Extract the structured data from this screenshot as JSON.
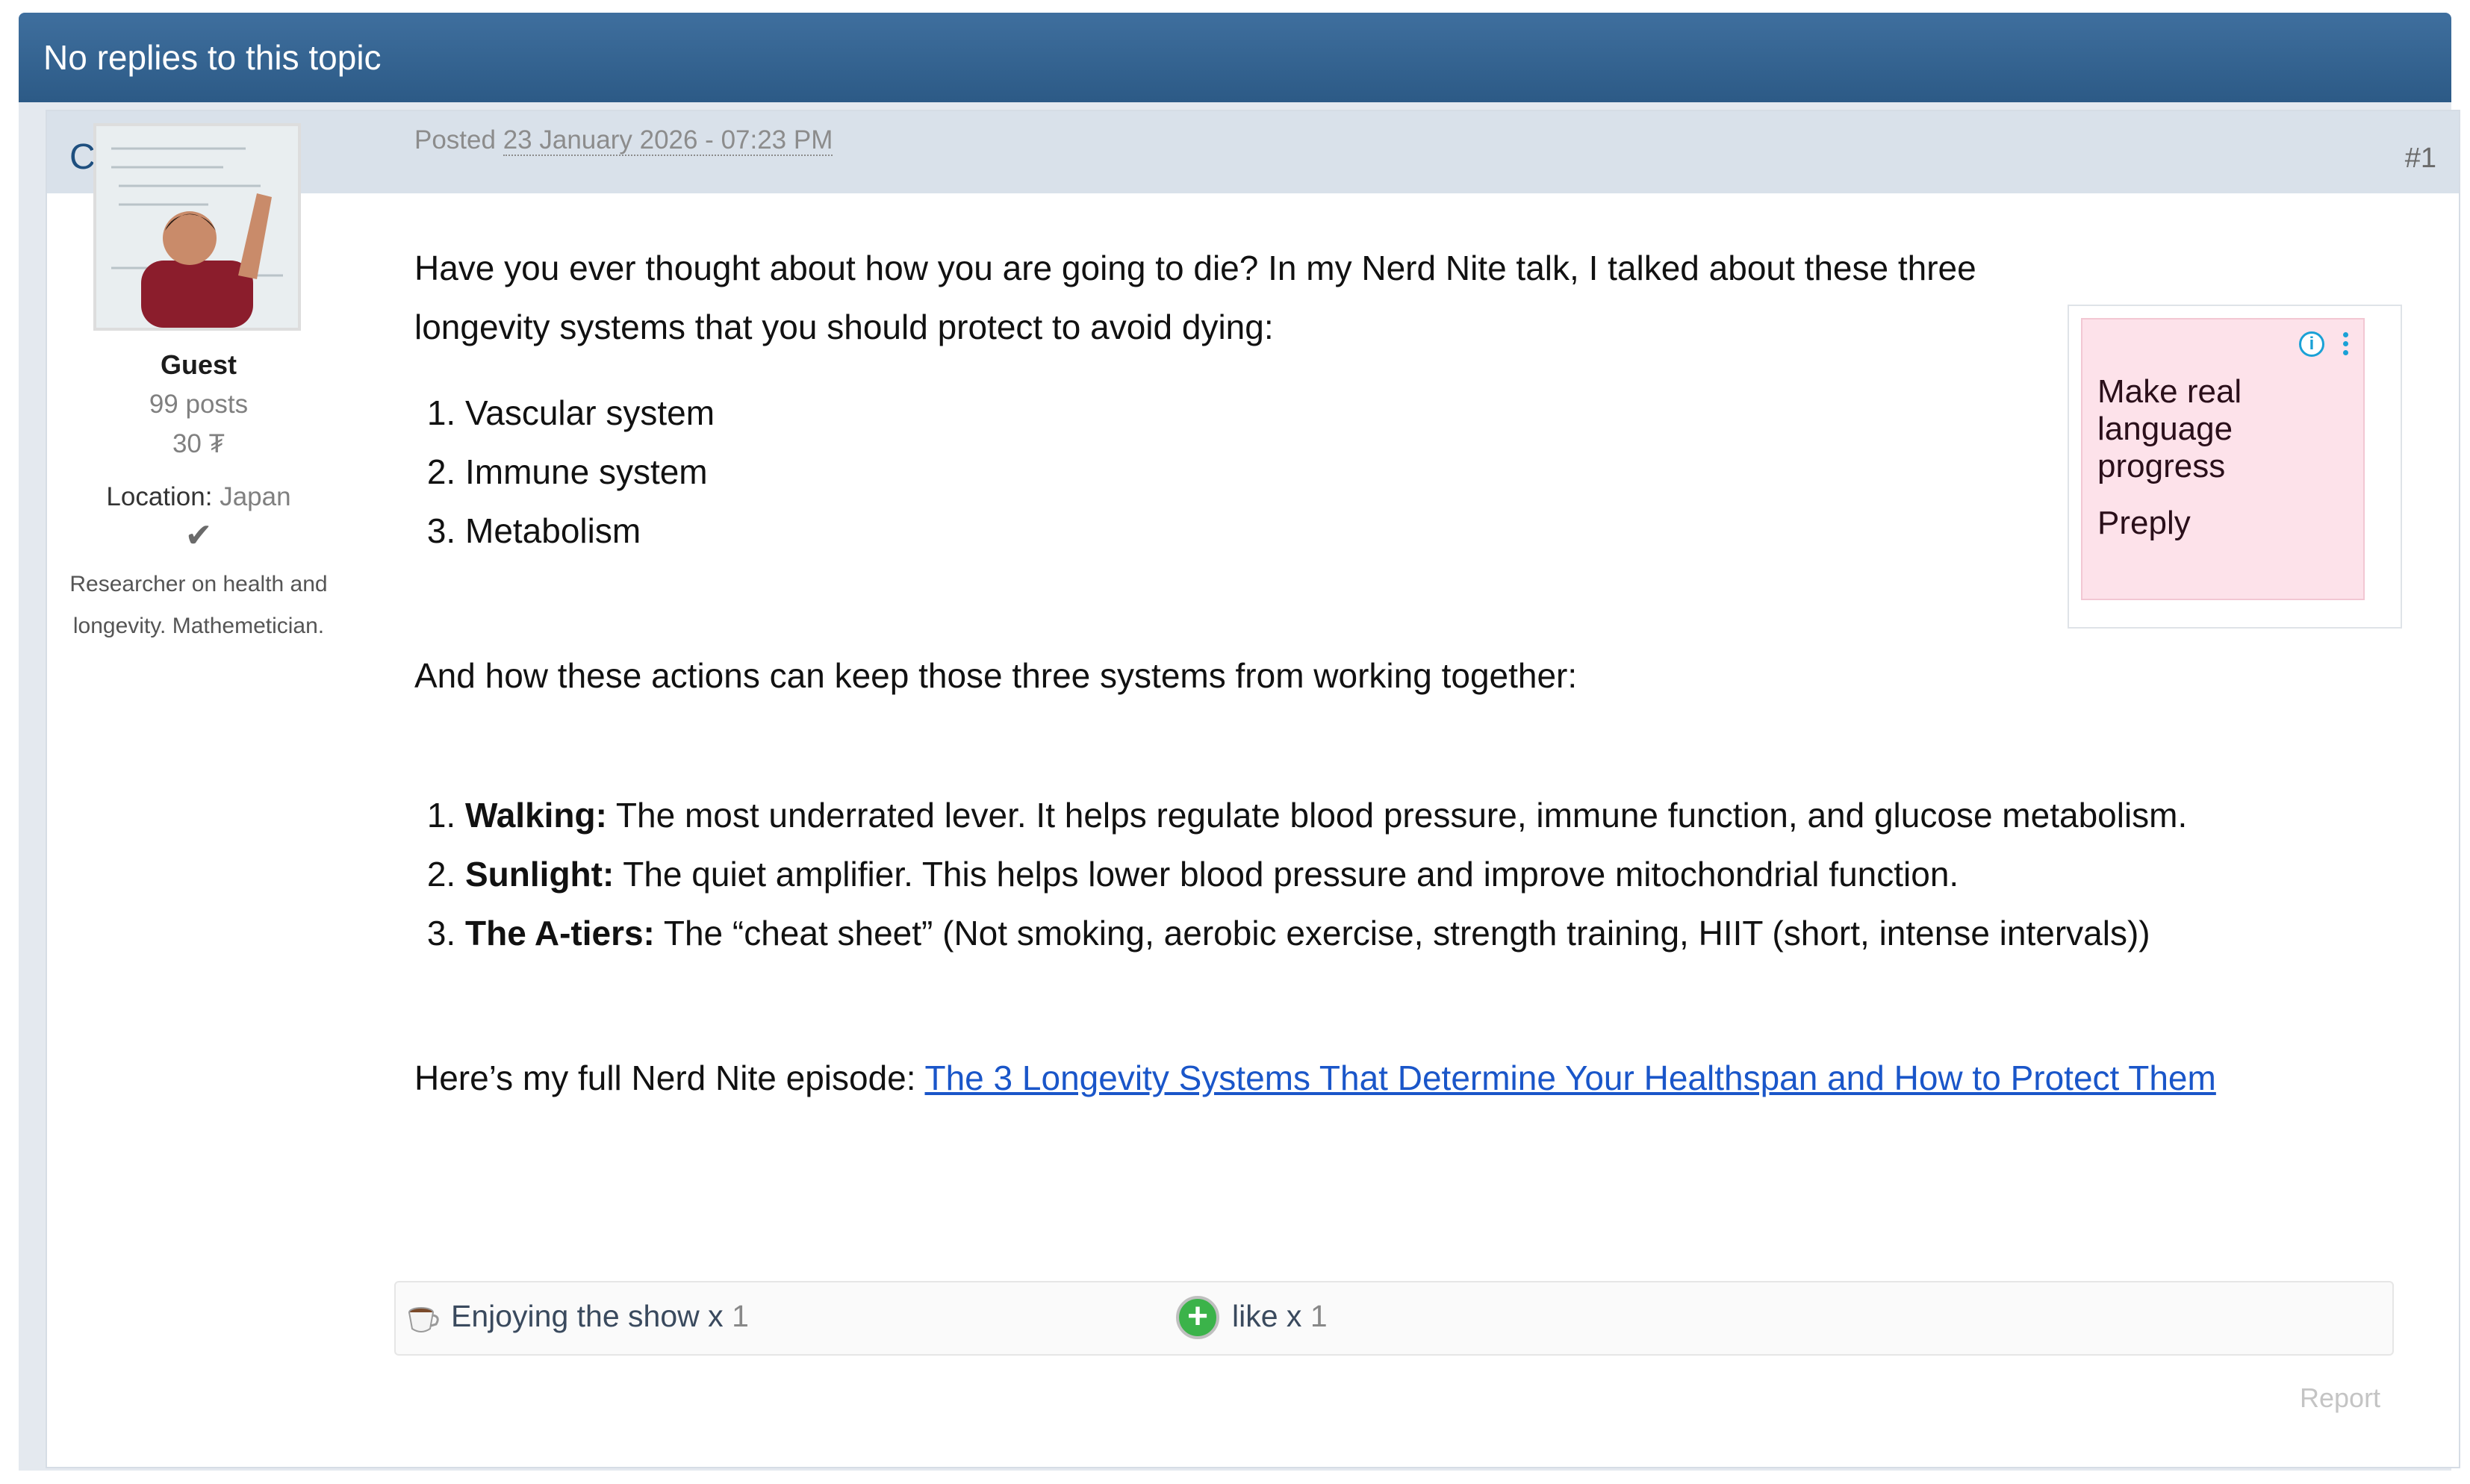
{
  "topic_bar": {
    "title": "No replies to this topic"
  },
  "post": {
    "author": "Cloomis",
    "number": "#1",
    "posted_label": "Posted",
    "posted_date": "23 January 2026 - 07:23 PM",
    "body": {
      "intro": "Have you ever thought about how you are going to die? In my Nerd Nite talk, I talked about these three longevity systems that you should protect to avoid dying:",
      "systems": [
        "Vascular system",
        "Immune system",
        "Metabolism"
      ],
      "actions_intro": "And how these actions can keep those three systems from working together:",
      "actions": [
        {
          "title": "Walking:",
          "text": "The most underrated lever. It helps regulate blood pressure, immune function, and glucose metabolism."
        },
        {
          "title": "Sunlight:",
          "text": "The quiet amplifier. This helps lower blood pressure and improve mitochondrial function."
        },
        {
          "title": "The A-tiers:",
          "text": "The “cheat sheet” (Not smoking, aerobic exercise, strength training, HIIT (short, intense intervals))"
        }
      ],
      "episode_prefix": "Here’s my full Nerd Nite episode:",
      "episode_link": "The 3 Longevity Systems That Determine Your Healthspan and How to Protect Them"
    }
  },
  "sidebar": {
    "role": "Guest",
    "posts": "99 posts",
    "money": "30 ₮",
    "location_label": "Location:",
    "location_value": "Japan",
    "check": "✔",
    "bio": "Researcher on health and longevity. Mathemetician."
  },
  "ad": {
    "headline": "Make real language progress",
    "brand": "Preply",
    "info_glyph": "i"
  },
  "reputation": {
    "items": [
      {
        "label": "Enjoying the show x",
        "count": "1",
        "icon": "coffee-cup-icon"
      },
      {
        "label": "like x",
        "count": "1",
        "icon": "plus-icon"
      }
    ],
    "plus_glyph": "+"
  },
  "report_label": "Report",
  "colors": {
    "topic_bar": "#2c5a86",
    "author": "#1e4f7f",
    "link": "#1a56c9",
    "ad_bg": "#fde2ea",
    "like_green": "#3bb34a"
  }
}
